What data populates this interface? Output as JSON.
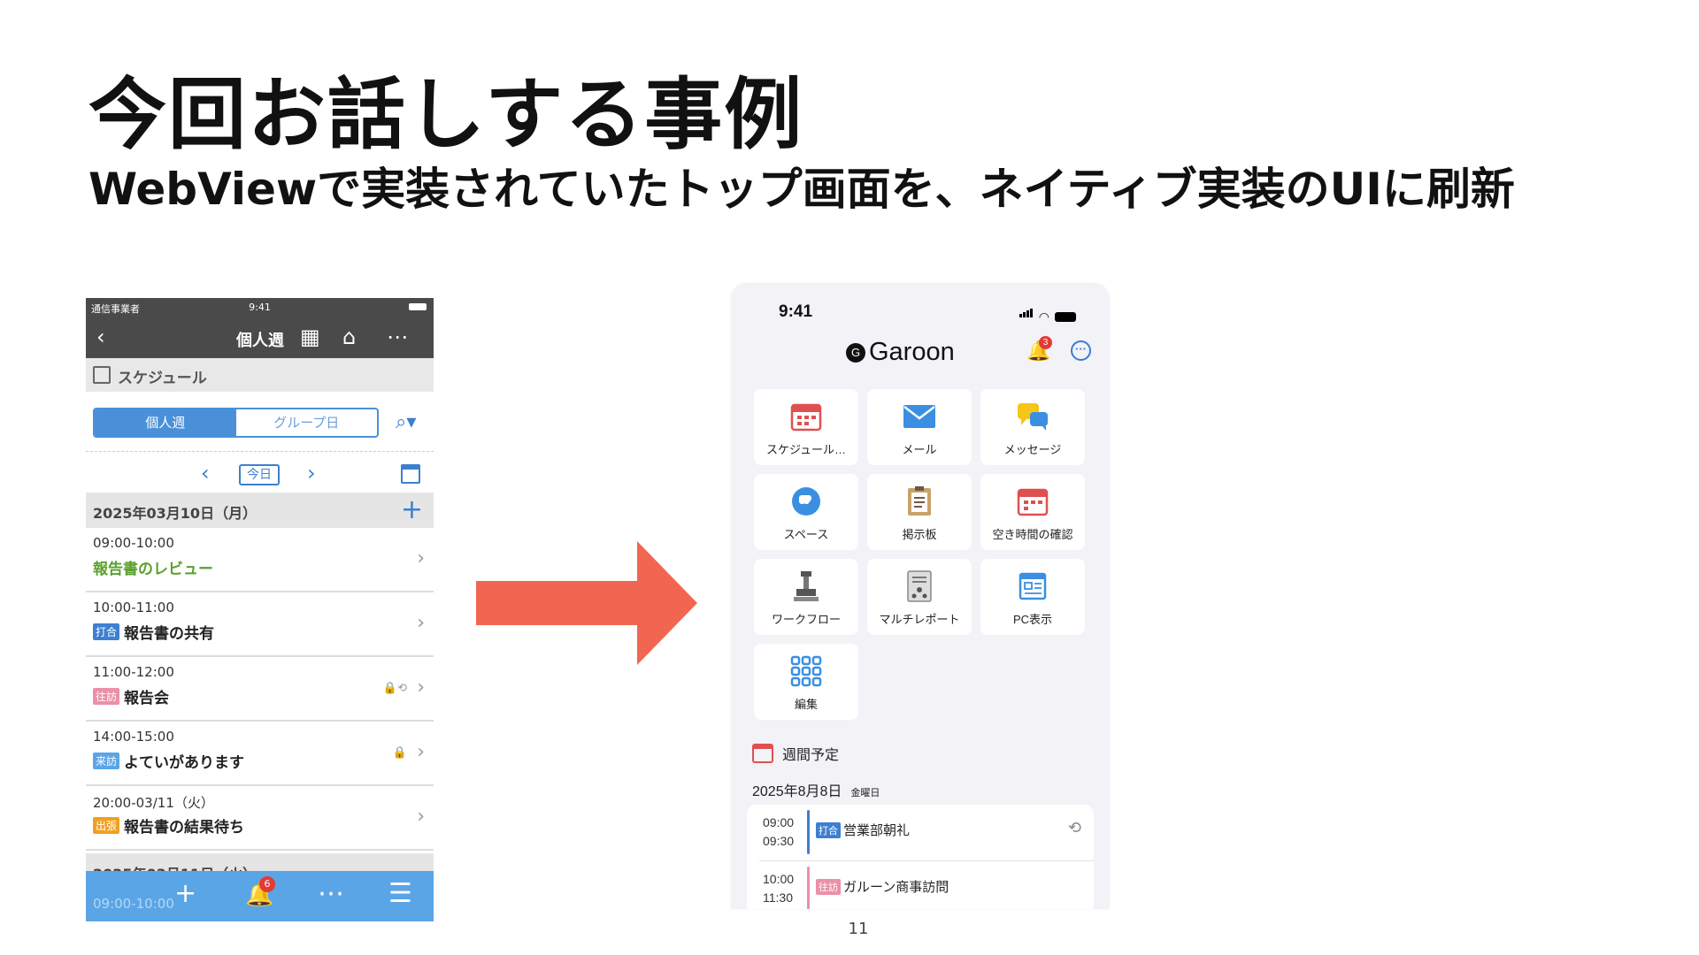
{
  "slide": {
    "title": "今回お話しする事例",
    "subtitle": "WebViewで実装されていたトップ画面を、ネイティブ実装のUIに刷新",
    "page_number": "11"
  },
  "old_screen": {
    "status_carrier": "通信事業者",
    "status_time": "9:41",
    "nav_title": "個人週",
    "section_label": "スケジュール",
    "segments": [
      "個人週",
      "グループ日"
    ],
    "today_label": "今日",
    "day1_header": "2025年03月10日（月）",
    "events": [
      {
        "time": "09:00-10:00",
        "badge": "",
        "title": "報告書のレビュー"
      },
      {
        "time": "10:00-11:00",
        "badge": "打合",
        "title": "報告書の共有"
      },
      {
        "time": "11:00-12:00",
        "badge": "往訪",
        "title": "報告会"
      },
      {
        "time": "14:00-15:00",
        "badge": "来訪",
        "title": "よていがあります"
      },
      {
        "time": "20:00-03/11（火）",
        "badge": "出張",
        "title": "報告書の結果待ち"
      }
    ],
    "day2_header": "2025年03月11日（火）",
    "ghost_time": "09:00-10:00",
    "notification_count": "6"
  },
  "new_screen": {
    "status_time": "9:41",
    "logo_text": "Garoon",
    "logo_mark": "G",
    "bell_badge": "3",
    "tiles": [
      {
        "label": "スケジュール…",
        "icon": "calendar-icon"
      },
      {
        "label": "メール",
        "icon": "mail-icon"
      },
      {
        "label": "メッセージ",
        "icon": "message-icon"
      },
      {
        "label": "スペース",
        "icon": "space-icon"
      },
      {
        "label": "掲示板",
        "icon": "bulletin-icon"
      },
      {
        "label": "空き時間の確認",
        "icon": "availability-icon"
      },
      {
        "label": "ワークフロー",
        "icon": "workflow-icon"
      },
      {
        "label": "マルチレポート",
        "icon": "report-icon"
      },
      {
        "label": "PC表示",
        "icon": "pc-view-icon"
      },
      {
        "label": "編集",
        "icon": "edit-grid-icon"
      }
    ],
    "weekly_label": "週間予定",
    "weekly_date": "2025年8月8日",
    "weekly_weekday": "金曜日",
    "events": [
      {
        "start": "09:00",
        "end": "09:30",
        "badge": "打合",
        "title": "営業部朝礼"
      },
      {
        "start": "10:00",
        "end": "11:30",
        "badge": "往訪",
        "title": "ガルーン商事訪問"
      }
    ]
  },
  "colors": {
    "arrow": "#f26651",
    "old_accent": "#4a90d9",
    "badge_meeting": "#3d7fd0",
    "badge_visit": "#ec8fa8",
    "badge_guest": "#5aa5e6",
    "badge_trip": "#f0a020"
  }
}
